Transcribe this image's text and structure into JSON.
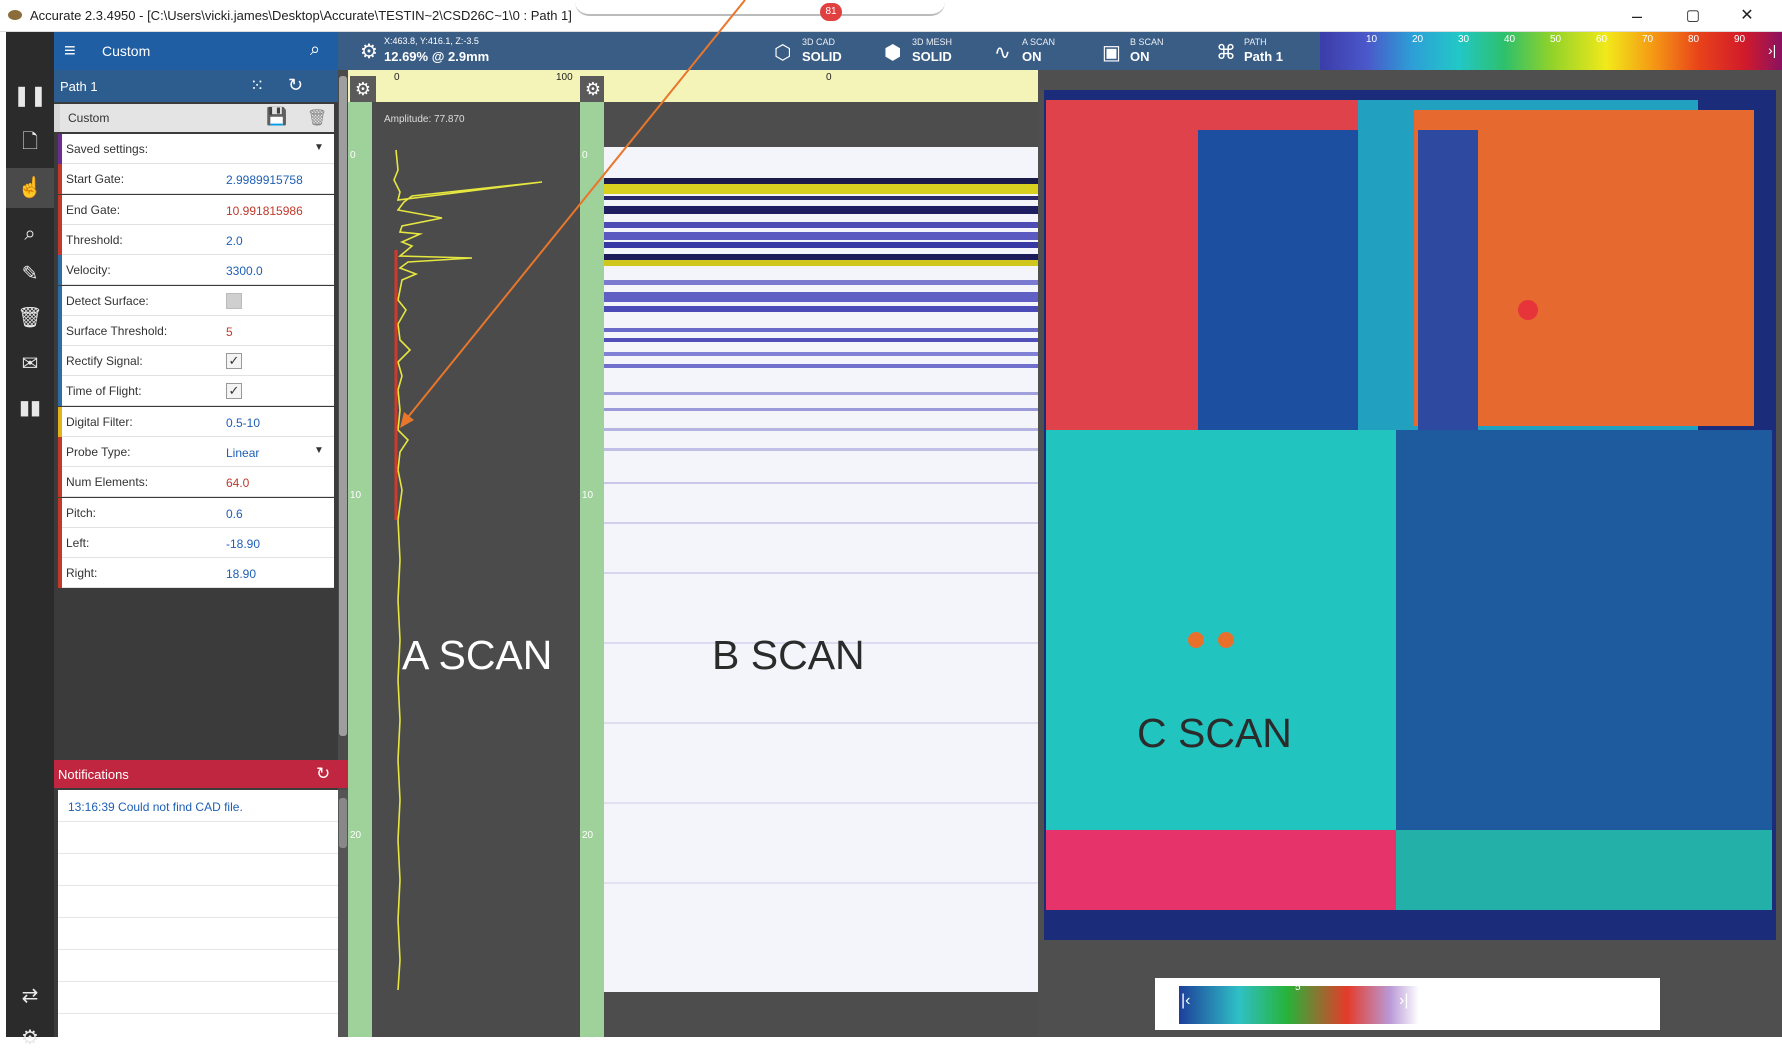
{
  "window": {
    "title": "Accurate 2.3.4950 - [C:\\Users\\vicki.james\\Desktop\\Accurate\\TESTIN~2\\CSD26C~1\\0 : Path 1]",
    "badge": "81",
    "minimize": "–",
    "maximize": "▢",
    "close": "✕"
  },
  "sidebar_panel": {
    "header_label": "Custom",
    "path_label": "Path 1",
    "custom_label": "Custom",
    "params": [
      {
        "key": "Saved settings:",
        "value": "",
        "type": "dropdown",
        "color": "#6b2c91"
      },
      {
        "key": "Start Gate:",
        "value": "2.9989915758",
        "type": "text",
        "color": "#c0392b"
      },
      {
        "key": "End Gate:",
        "value": "10.991815986",
        "type": "text-red",
        "color": "#c0392b"
      },
      {
        "key": "Threshold:",
        "value": "2.0",
        "type": "text",
        "color": "#c0392b"
      },
      {
        "key": "Velocity:",
        "value": "3300.0",
        "type": "text",
        "color": "#2e6da4"
      },
      {
        "key": "Detect Surface:",
        "value": "",
        "type": "checkbox-off",
        "color": "#2e6da4"
      },
      {
        "key": "Surface Threshold:",
        "value": "5",
        "type": "text-red",
        "color": "#2e6da4"
      },
      {
        "key": "Rectify Signal:",
        "value": "✓",
        "type": "checkbox",
        "color": "#2e6da4"
      },
      {
        "key": "Time of Flight:",
        "value": "✓",
        "type": "checkbox",
        "color": "#2e6da4"
      },
      {
        "key": "Digital Filter:",
        "value": "0.5-10",
        "type": "text",
        "color": "#e0b31b"
      },
      {
        "key": "Probe Type:",
        "value": "Linear",
        "type": "dropdown",
        "color": "#c0392b"
      },
      {
        "key": "Num Elements:",
        "value": "64.0",
        "type": "text-red",
        "color": "#c0392b"
      },
      {
        "key": "Pitch:",
        "value": "0.6",
        "type": "text",
        "color": "#c0392b"
      },
      {
        "key": "Left:",
        "value": "-18.90",
        "type": "text",
        "color": "#c0392b"
      },
      {
        "key": "Right:",
        "value": "18.90",
        "type": "text",
        "color": "#c0392b"
      }
    ]
  },
  "notifications": {
    "title": "Notifications",
    "items": [
      "13:16:39  Could not find CAD file."
    ]
  },
  "toolbar": {
    "coords": "X:463.8, Y:416.1, Z:-3.5",
    "progress": "12.69% @ 2.9mm",
    "buttons": [
      {
        "top": "3D CAD",
        "bottom": "SOLID",
        "icon": "cube-icon"
      },
      {
        "top": "3D MESH",
        "bottom": "SOLID",
        "icon": "mesh-cube-icon"
      },
      {
        "top": "A SCAN",
        "bottom": "ON",
        "icon": "ascan-wave-icon"
      },
      {
        "top": "B SCAN",
        "bottom": "ON",
        "icon": "bscan-frame-icon"
      },
      {
        "top": "PATH",
        "bottom": "Path 1",
        "icon": "path-icon"
      }
    ],
    "colorbar_ticks": [
      "10",
      "20",
      "30",
      "40",
      "50",
      "60",
      "70",
      "80",
      "90"
    ]
  },
  "ascan": {
    "ruler_start": "0",
    "ruler_end": "100",
    "amplitude_label": "Amplitude: 77.870",
    "depth_ticks": [
      "0",
      "10",
      "20"
    ],
    "overlay_label": "A SCAN"
  },
  "bscan": {
    "ruler_start": "0",
    "depth_ticks": [
      "0",
      "10",
      "20"
    ],
    "overlay_label": "B SCAN"
  },
  "cscan": {
    "overlay_label": "C SCAN",
    "legend_tick": "5"
  },
  "colors": {
    "accent_blue": "#1f5ea3",
    "notification_red": "#c0263f",
    "ascan_trace": "#e8e84a",
    "annotation_arrow": "#e8762b"
  }
}
